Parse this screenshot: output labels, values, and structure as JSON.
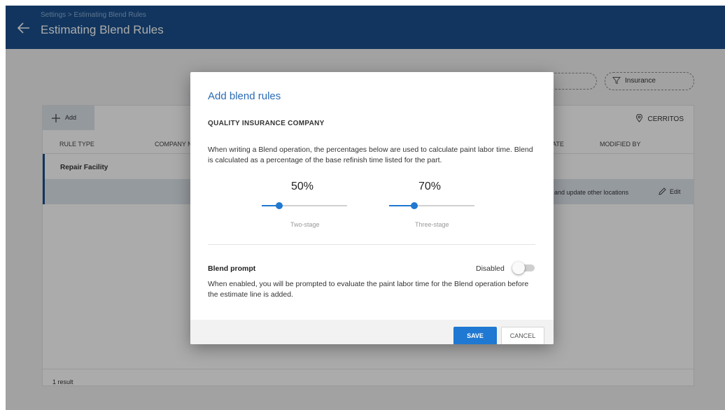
{
  "header": {
    "breadcrumb": "Settings > Estimating Blend Rules",
    "title": "Estimating Blend Rules"
  },
  "filters": {
    "insurance_chip": "Insurance"
  },
  "toolbar": {
    "add_label": "Add",
    "location_label": "CERRITOS"
  },
  "table": {
    "columns": [
      "Rule Type",
      "Company Na",
      "ate",
      "Modified By"
    ],
    "rows": [
      {
        "rule_type": "Repair Facility"
      },
      {
        "overflow_text": "and update other locations",
        "edit_label": "Edit"
      }
    ],
    "result_count": "1 result"
  },
  "modal": {
    "title": "Add blend rules",
    "company": "QUALITY INSURANCE COMPANY",
    "description": "When writing a Blend operation, the percentages below are used to calculate paint labor time. Blend is calculated as a percentage of the base refinish time listed for the part.",
    "sliders": [
      {
        "value_label": "50%",
        "value": 50,
        "label": "Two-stage"
      },
      {
        "value_label": "70%",
        "value": 70,
        "label": "Three-stage"
      }
    ],
    "blend_prompt": {
      "title": "Blend prompt",
      "state_label": "Disabled",
      "enabled": false,
      "description": "When enabled, you will be prompted to evaluate the paint labor time for the Blend operation before the estimate line is added."
    },
    "save_label": "SAVE",
    "cancel_label": "CANCEL"
  },
  "colors": {
    "header_bg": "#1a4f8c",
    "accent": "#1f78d1",
    "modal_title": "#2a6bb5"
  }
}
